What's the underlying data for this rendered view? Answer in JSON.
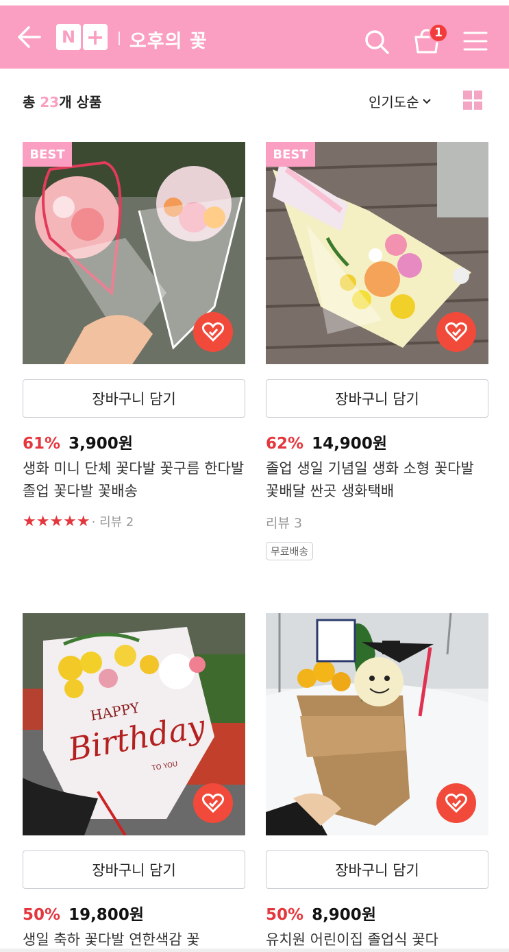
{
  "header": {
    "logo_left": "N",
    "logo_right": "+",
    "store_name": "오후의 꽃",
    "cart_count": "1",
    "accent_color": "#fa9fc1"
  },
  "toolbar": {
    "count_prefix": "총 ",
    "count_number": "23",
    "count_suffix": "개 상품",
    "sort_label": "인기도순",
    "sort_icon": "chevron-down-icon",
    "view_icon": "grid-view-icon"
  },
  "products": [
    {
      "badge": "BEST",
      "cart_button": "장바구니 담기",
      "discount": "61%",
      "price": "3,900원",
      "name": "생화 미니 단체 꽃다발 꽃구름 한다발 졸업 꽃다발 꽃배송",
      "stars": "★★★★★",
      "review": "· 리뷰 2",
      "rating": 5
    },
    {
      "badge": "BEST",
      "cart_button": "장바구니 담기",
      "discount": "62%",
      "price": "14,900원",
      "name": "졸업 생일 기념일 생화 소형 꽃다발 꽃배달 싼곳 생화택배",
      "review": "리뷰 3",
      "shipping": "무료배송"
    },
    {
      "cart_button": "장바구니 담기",
      "discount": "50%",
      "price": "19,800원",
      "name": "생일 축하 꽃다발 연한색감 꽃",
      "image_text": "HAPPY Birthday TO YOU"
    },
    {
      "cart_button": "장바구니 담기",
      "discount": "50%",
      "price": "8,900원",
      "name": "유치원 어린이집 졸업식 꽃다"
    }
  ]
}
